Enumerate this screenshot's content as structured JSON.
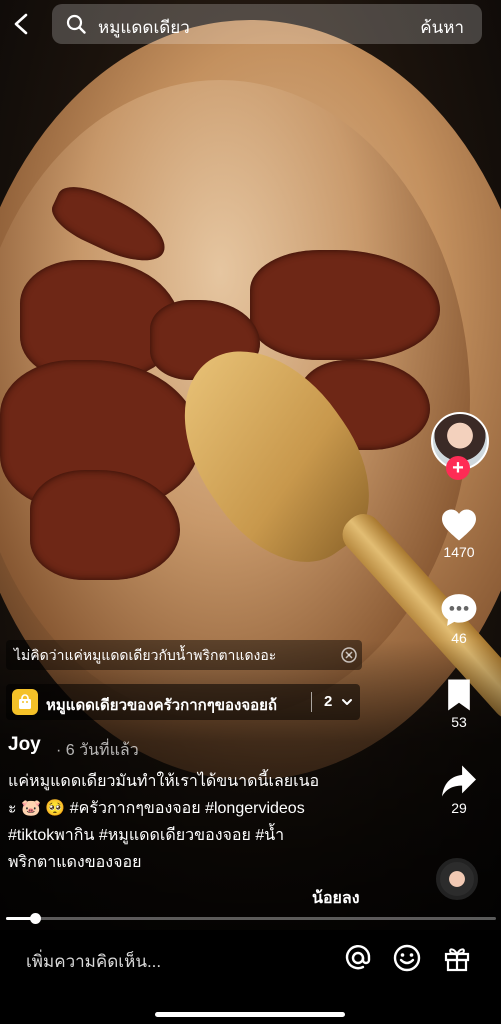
{
  "search": {
    "query": "หมูแดดเดียว",
    "button_label": "ค้นหา"
  },
  "rail": {
    "likes": "1470",
    "comments": "46",
    "saves": "53",
    "shares": "29"
  },
  "caption_overlay": "ไม่คิดว่าแค่หมูแดดเดียวกับน้ำพริกตาแดงอะ",
  "playlist": {
    "title": "หมูแดดเดียวของครัวกากๆของจอยถ้",
    "count": "2"
  },
  "post": {
    "author": "Joy",
    "posted": "· 6 วันที่แล้ว",
    "desc_lines": [
      "แค่หมูแดดเดียวมันทำให้เราได้ขนาดนี้เลยเนอ",
      "ะ 🐷 🥺 #ครัวกากๆของจอย #longervideos",
      "#tiktokพากิน #หมูแดดเดียวของจอย #น้ำ",
      "พริกตาแดงของจอย"
    ],
    "see_less": "น้อยลง"
  },
  "playback": {
    "progress": 0.06
  },
  "comment_bar": {
    "placeholder": "เพิ่มความคิดเห็น..."
  },
  "colors": {
    "accent": "#fe2c55",
    "bag": "#f4c128"
  }
}
